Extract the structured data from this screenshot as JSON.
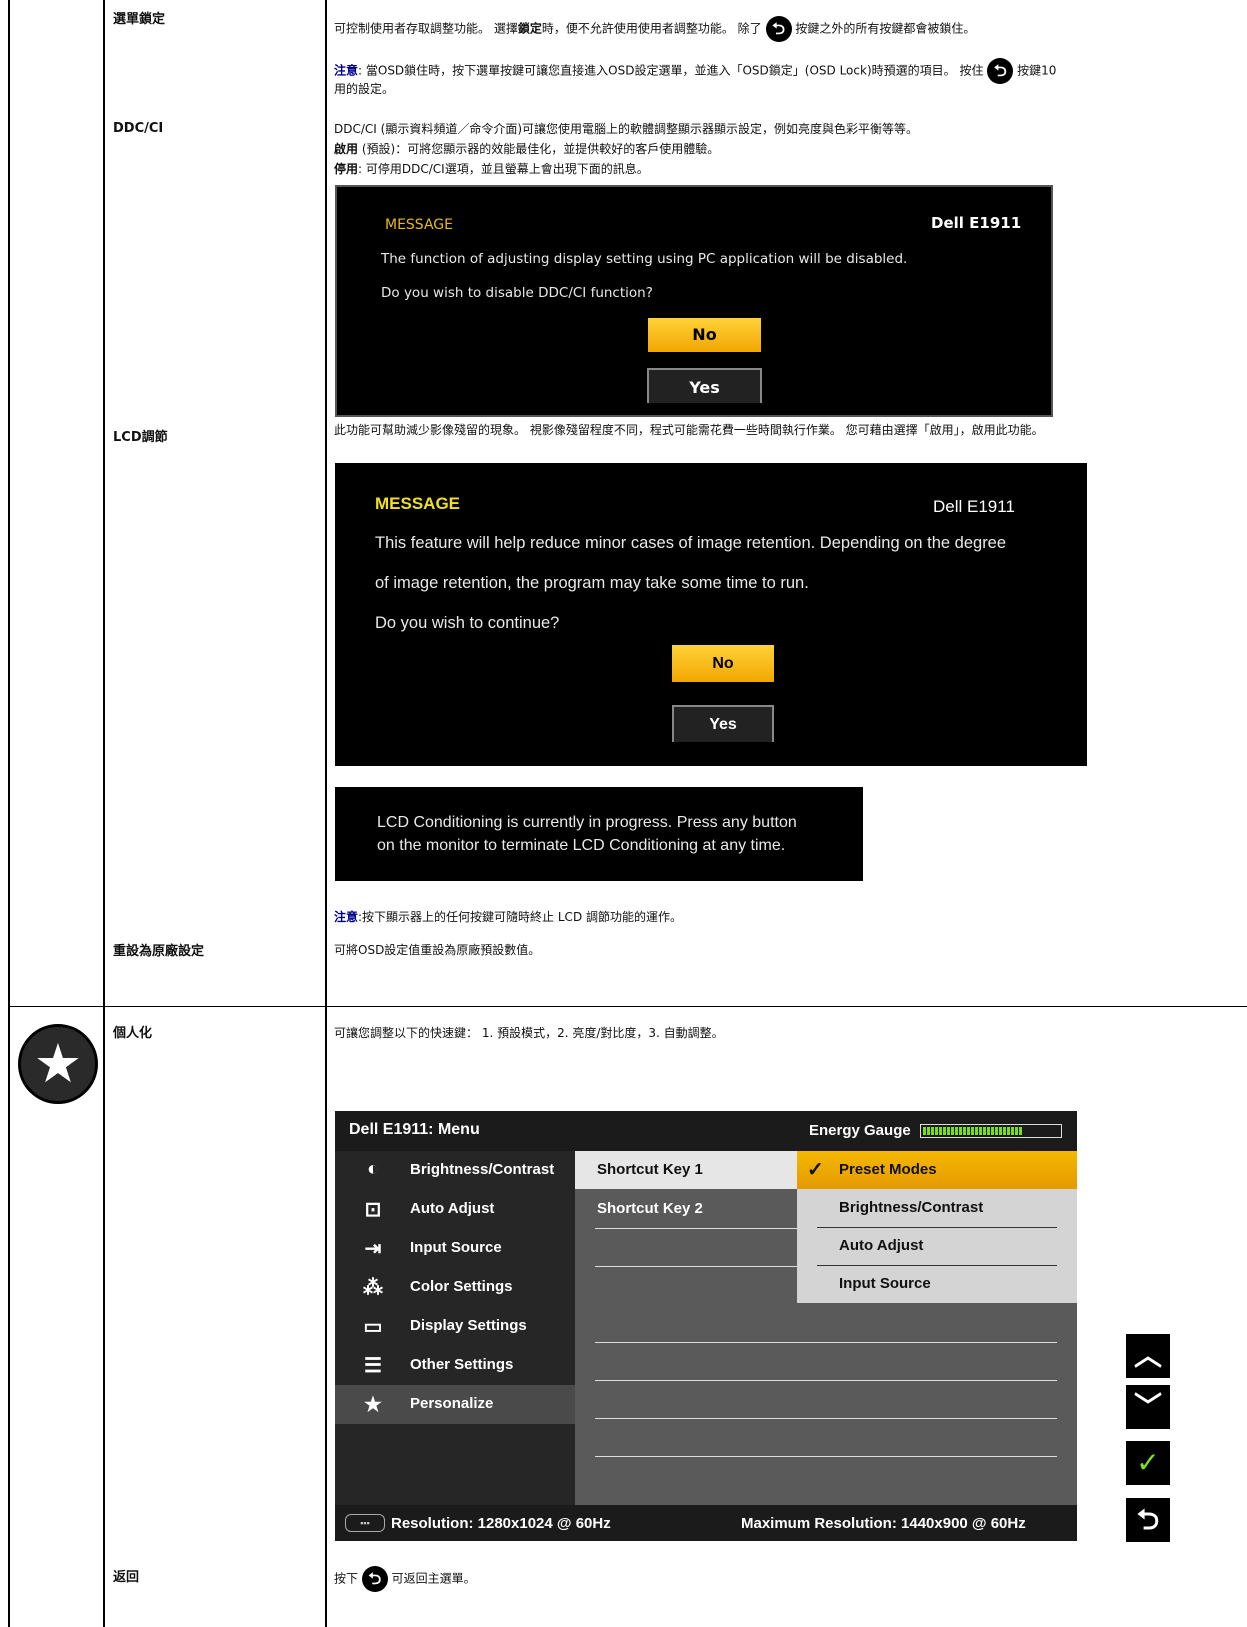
{
  "rows": {
    "menu_lock": {
      "label": "選單鎖定",
      "line1_a": "可控制使用者存取調整功能。 選擇",
      "line1_b": "鎖定",
      "line1_c": "時，便不允許使用使用者調整功能。 除了",
      "line1_d": "按鍵之外的所有按鍵都會被鎖住。",
      "note_key": "注意",
      "note_a": ": 當OSD鎖住時，按下選單按鍵可讓您直接進入OSD設定選單，並進入「OSD鎖定」(OSD Lock)時預選的項目。 按住",
      "note_b": "按鍵10",
      "note_line2": "用的設定。"
    },
    "ddcci": {
      "label": "DDC/CI",
      "line1": "DDC/CI (顯示資料頻道／命令介面)可讓您使用電腦上的軟體調整顯示器顯示設定，例如亮度與色彩平衡等等。",
      "enable_key": "啟用",
      "enable_text": " (預設)：可將您顯示器的效能最佳化，並提供較好的客戶使用體驗。",
      "disable_key": "停用",
      "disable_text": ": 可停用DDC/CI選項，並且螢幕上會出現下面的訊息。",
      "dialog": {
        "title": "MESSAGE",
        "model": "Dell E1911",
        "line1": "The function of adjusting display setting using PC application will be disabled.",
        "line2": "Do you wish to disable DDC/CI function?",
        "no": "No",
        "yes": "Yes"
      }
    },
    "lcd": {
      "label": "LCD調節",
      "line1": "此功能可幫助減少影像殘留的現象。 視影像殘留程度不同，程式可能需花費一些時間執行作業。 您可藉由選擇「啟用」，啟用此功能。",
      "dialog": {
        "title": "MESSAGE",
        "model": "Dell E1911",
        "line1": "This feature will help reduce minor cases of image retention. Depending on the degree",
        "line2": "of image retention, the program may take some time to run.",
        "line3": "Do you wish to continue?",
        "no": "No",
        "yes": "Yes"
      },
      "progress_line1": "LCD Conditioning is currently in progress. Press any button",
      "progress_line2": "on the monitor to terminate LCD Conditioning at any time.",
      "note_key": "注意",
      "note_text": ":按下顯示器上的任何按鍵可隨時終止 LCD 調節功能的運作。"
    },
    "reset": {
      "label": "重設為原廠設定",
      "text": "可將OSD設定值重設為原廠預設數值。"
    },
    "personalize": {
      "label": "個人化",
      "text": "可讓您調整以下的快速鍵： 1. 預設模式，2. 亮度/對比度，3. 自動調整。",
      "icon": "star-icon"
    },
    "back": {
      "label": "返回",
      "text_a": "按下",
      "text_b": "可返回主選單。"
    }
  },
  "osd": {
    "title": "Dell E1911: Menu",
    "energy_label": "Energy Gauge",
    "energy_level": 0.72,
    "menu": [
      {
        "label": "Brightness/Contrast",
        "icon": "brightness-icon",
        "glyph": "◐"
      },
      {
        "label": "Auto Adjust",
        "icon": "auto-adjust-icon",
        "glyph": "⊡"
      },
      {
        "label": "Input Source",
        "icon": "input-source-icon",
        "glyph": "⇥"
      },
      {
        "label": "Color Settings",
        "icon": "color-settings-icon",
        "glyph": "⁂"
      },
      {
        "label": "Display Settings",
        "icon": "display-settings-icon",
        "glyph": "▭"
      },
      {
        "label": "Other Settings",
        "icon": "other-settings-icon",
        "glyph": "☰"
      },
      {
        "label": "Personalize",
        "icon": "star-icon",
        "glyph": "★"
      }
    ],
    "shortcuts": [
      "Shortcut Key 1",
      "Shortcut Key 2"
    ],
    "options": [
      "Preset Modes",
      "Brightness/Contrast",
      "Auto Adjust",
      "Input Source"
    ],
    "resolution": "Resolution: 1280x1024 @ 60Hz",
    "max_resolution": "Maximum Resolution: 1440x900 @ 60Hz"
  },
  "nav_buttons": {
    "up": "up-arrow-icon",
    "down": "down-arrow-icon",
    "check": "check-icon",
    "back": "back-icon"
  }
}
